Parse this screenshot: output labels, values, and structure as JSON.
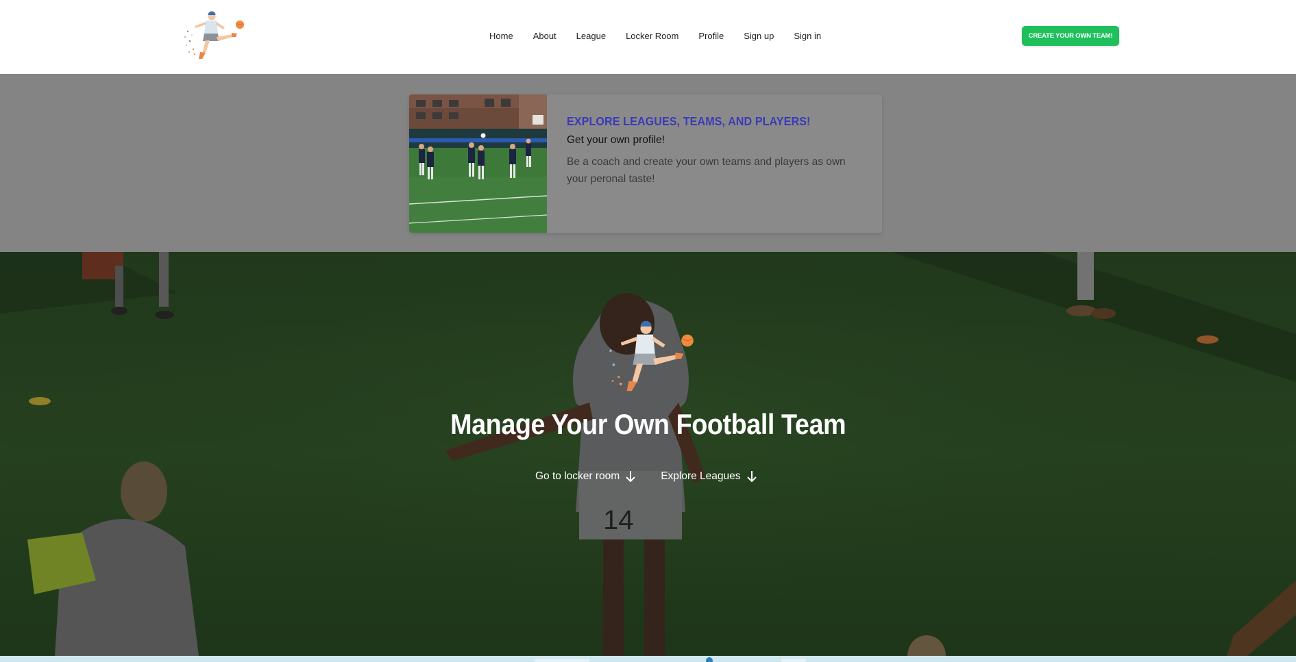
{
  "nav": {
    "items": [
      {
        "label": "Home"
      },
      {
        "label": "About"
      },
      {
        "label": "League"
      },
      {
        "label": "Locker Room"
      },
      {
        "label": "Profile"
      },
      {
        "label": "Sign up"
      },
      {
        "label": "Sign in"
      }
    ],
    "cta_label": "CREATE YOUR OWN TEAM!"
  },
  "feature_card": {
    "title": "EXPLORE LEAGUES, TEAMS, AND PLAYERS!",
    "subtitle": "Get your own profile!",
    "text": "Be a coach and create your own teams and players as own your peronal taste!"
  },
  "hero": {
    "title": "Manage Your Own Football Team",
    "links": [
      {
        "label": "Go to locker room"
      },
      {
        "label": "Explore Leagues"
      }
    ]
  },
  "icons": {
    "logo": "footballer-kicking-logo",
    "hero_logo": "footballer-kicking-logo",
    "link_arrow": "arrow-down-icon"
  },
  "colors": {
    "cta": "#1fc05c",
    "card_title": "#3c3ab8",
    "grey_overlay": "#848484"
  }
}
